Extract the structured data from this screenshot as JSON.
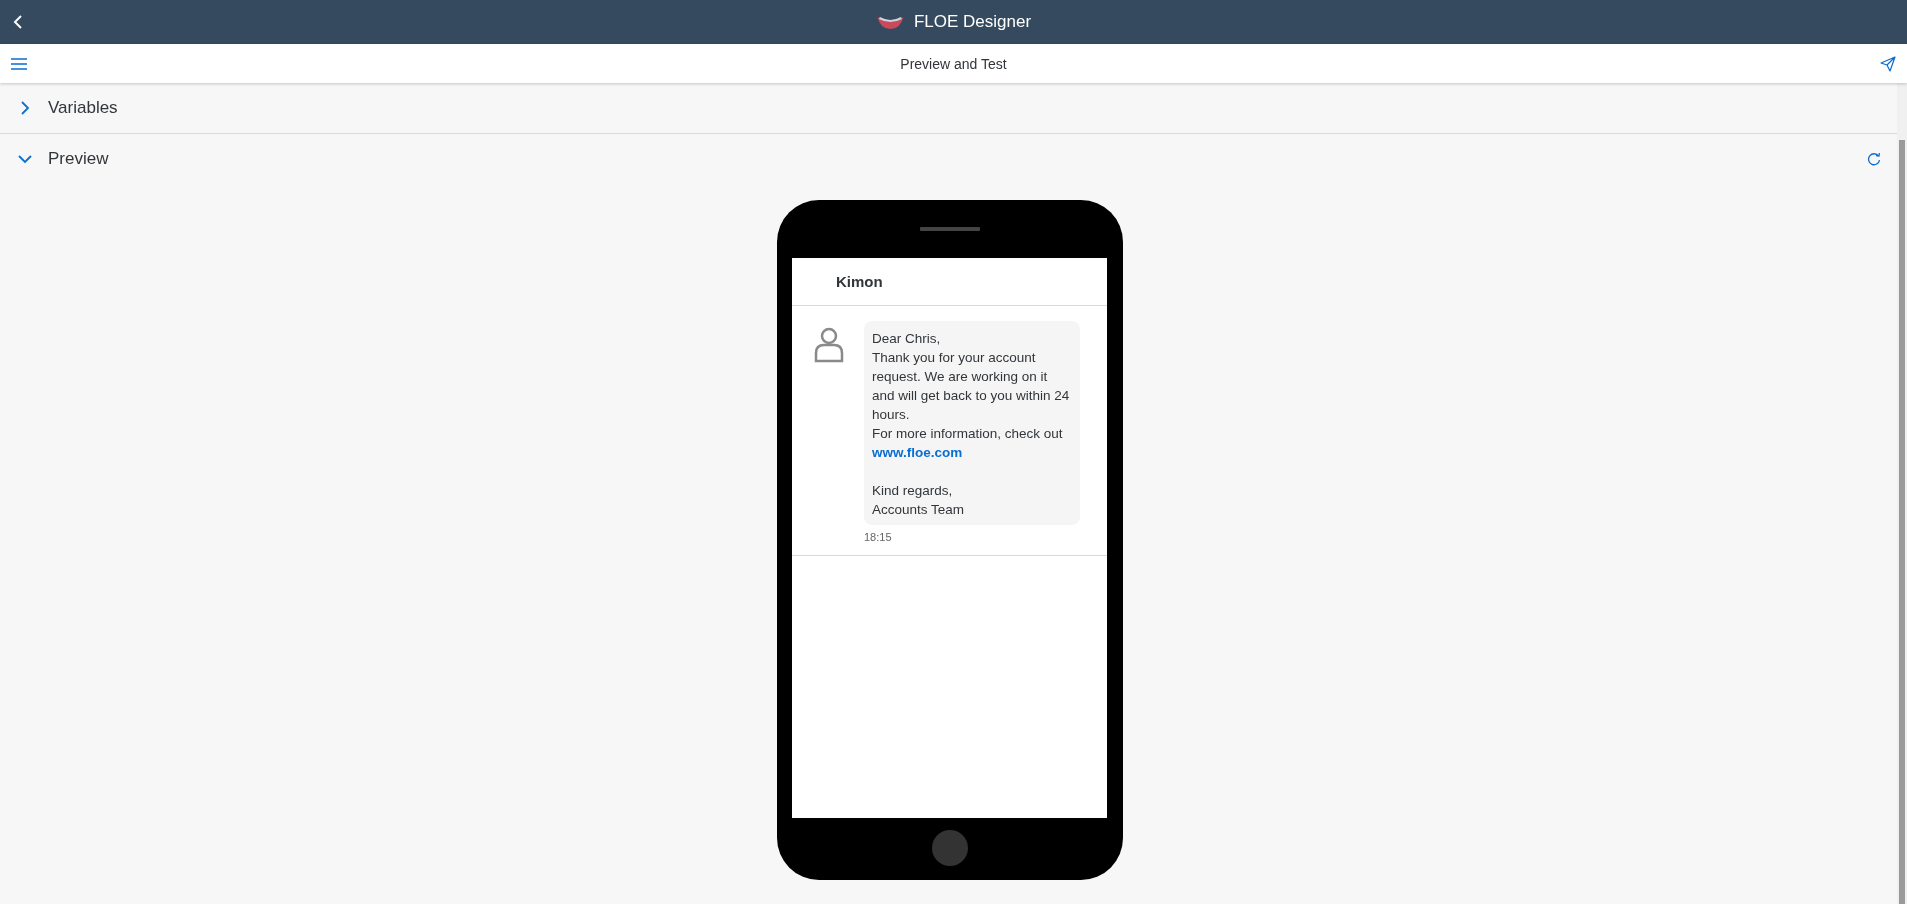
{
  "app_title": "FLOE Designer",
  "page_title": "Preview and Test",
  "sections": [
    {
      "label": "Variables",
      "expanded": false
    },
    {
      "label": "Preview",
      "expanded": true
    }
  ],
  "chat": {
    "contact": "Kimon",
    "message": {
      "greeting": "Dear Chris,",
      "body": "Thank you for your account request. We are working on it and will get back to you within 24 hours.",
      "info": "For more information, check out",
      "link": "www.floe.com",
      "closing": "Kind regards,",
      "signature": "Accounts Team"
    },
    "time": "18:15"
  }
}
